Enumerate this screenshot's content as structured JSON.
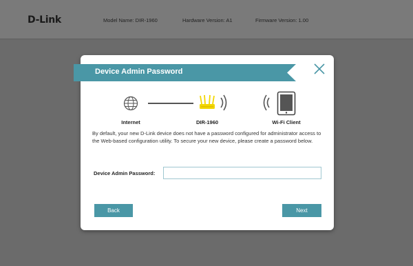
{
  "header": {
    "brand": "D-Link",
    "model_name": "Model Name: DIR-1960",
    "hardware_version": "Hardware Version: A1",
    "firmware_version": "Firmware Version: 1.00"
  },
  "dialog": {
    "title": "Device Admin Password",
    "diagram": {
      "internet_label": "Internet",
      "router_label": "DIR-1960",
      "client_label": "Wi-Fi Client"
    },
    "description": "By default, your new D-Link device does not have a password configured for administrator access to the Web-based configuration utility. To secure your new device, please create a password below.",
    "password_label": "Device Admin Password:",
    "password_value": "",
    "back_label": "Back",
    "next_label": "Next"
  },
  "colors": {
    "accent": "#4a97a6",
    "router": "#f2d600",
    "backdrop": "#6b6b6b"
  },
  "icons": [
    "globe-icon",
    "router-icon",
    "wifi-signal-icon",
    "tablet-icon",
    "close-icon"
  ]
}
